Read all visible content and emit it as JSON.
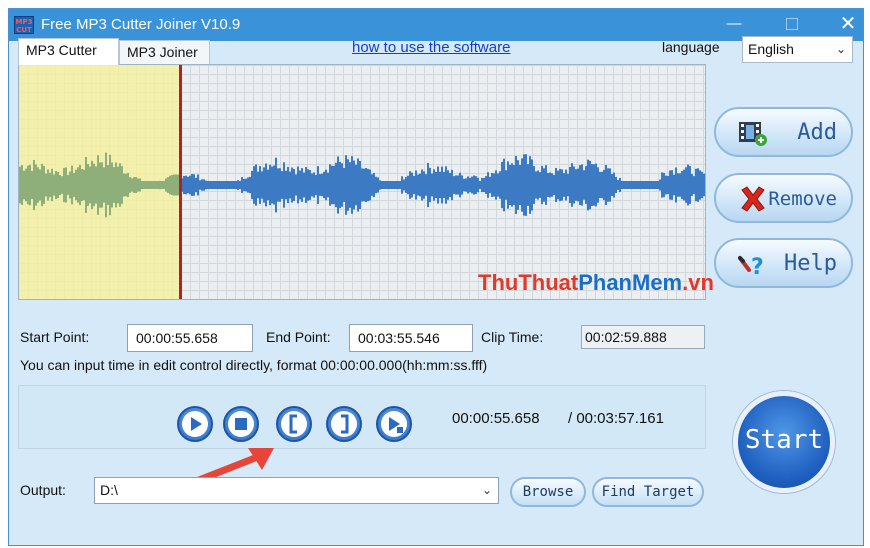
{
  "window": {
    "title": "Free MP3 Cutter Joiner V10.9",
    "icon_top": "MP3",
    "icon_bottom": "CUT",
    "controls": {
      "minimize": "—",
      "close": "✕"
    }
  },
  "tabs": [
    {
      "label": "MP3 Cutter",
      "selected": true
    },
    {
      "label": "MP3 Joiner",
      "selected": false
    }
  ],
  "howto_link": "how to use the software",
  "language": {
    "label": "language",
    "selected": "English"
  },
  "side_buttons": {
    "add": "Add",
    "remove": "Remove",
    "help": "Help"
  },
  "watermark": {
    "part1": "ThuThuat",
    "part2": "PhanMem",
    "part3": ".vn"
  },
  "times": {
    "start_label": "Start Point:",
    "start_value": "00:00:55.658",
    "end_label": "End Point:",
    "end_value": "00:03:55.546",
    "clip_label": "Clip Time:",
    "clip_value": "00:02:59.888"
  },
  "hint": "You can input time in edit control directly, format 00:00:00.000(hh:mm:ss.fff)",
  "playback": {
    "current": "00:00:55.658",
    "total": "/ 00:03:57.161"
  },
  "start_button": "Start",
  "output": {
    "label": "Output:",
    "value": "D:\\",
    "browse": "Browse",
    "find_target": "Find Target"
  },
  "colors": {
    "window_bg": "#d5e9f8",
    "titlebar": "#3a92d8",
    "waveform": "#3c7bc4",
    "selection": "#f3f0a0",
    "marker": "#b22222",
    "annotation_arrow": "#e8453a"
  }
}
